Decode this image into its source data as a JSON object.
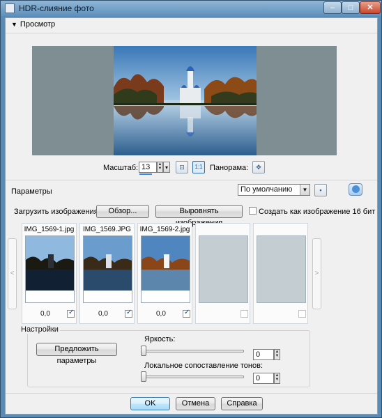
{
  "window": {
    "title": "HDR-слияние фото"
  },
  "preview": {
    "section_label": "Просмотр",
    "zoom_label": "Масштаб:",
    "zoom_value": "13",
    "pan_label": "Панорама:",
    "zoom_fit_icon": "zoom-fit-icon",
    "zoom_actual_label": "1:1"
  },
  "parameters": {
    "label": "Параметры",
    "preset_value": "По умолчанию"
  },
  "load": {
    "label": "Загрузить изображения:",
    "browse_label": "Обзор...",
    "align_label": "Выровнять изображения",
    "create16_label": "Создать как изображение 16 бит"
  },
  "thumbnails": [
    {
      "name": "IMG_1569-1.jpg",
      "ev": "0,0",
      "checked": true
    },
    {
      "name": "IMG_1569.JPG",
      "ev": "0,0",
      "checked": true
    },
    {
      "name": "IMG_1569-2.jpg",
      "ev": "0,0",
      "checked": true
    },
    {
      "name": "",
      "ev": "",
      "checked": false
    },
    {
      "name": "",
      "ev": "",
      "checked": false
    }
  ],
  "settings": {
    "title": "Настройки",
    "suggest_label": "Предложить параметры",
    "brightness_label": "Яркость:",
    "brightness_value": "0",
    "tone_label": "Локальное сопоставление тонов:",
    "tone_value": "0"
  },
  "footer": {
    "ok_label": "OK",
    "cancel_label": "Отмена",
    "help_label": "Справка"
  },
  "colors": {
    "title_bar": "#5f90ba",
    "preview_bg": "#7e8e92",
    "accent": "#3c7fb1"
  }
}
